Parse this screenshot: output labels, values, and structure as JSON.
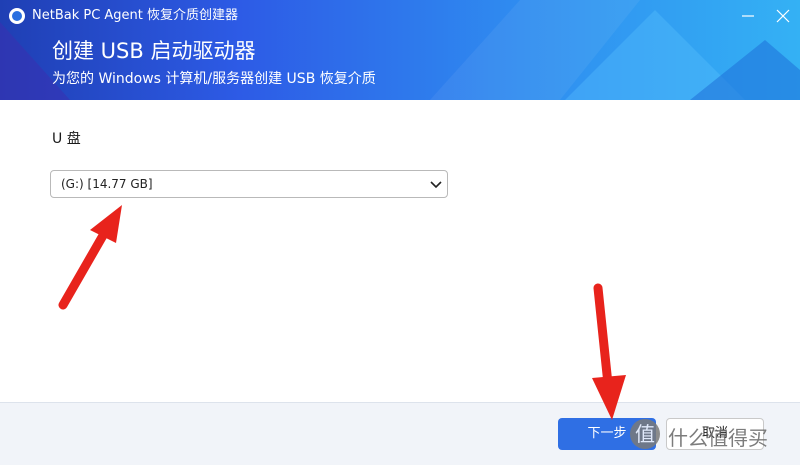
{
  "window": {
    "title": "NetBak PC Agent 恢复介质创建器"
  },
  "header": {
    "title": "创建 USB 启动驱动器",
    "subtitle": "为您的 Windows 计算机/服务器创建 USB 恢复介质"
  },
  "form": {
    "drive_label": "U 盘",
    "drive_selected": "(G:) [14.77 GB]"
  },
  "footer": {
    "next_label": "下一步",
    "cancel_label": "取消"
  },
  "watermark": {
    "icon_glyph": "值",
    "text": "什么值得买"
  },
  "colors": {
    "header_start": "#1f3fb4",
    "header_end": "#34b1f4",
    "primary_button": "#2f6fe4",
    "annotation_arrow": "#e8231c"
  }
}
